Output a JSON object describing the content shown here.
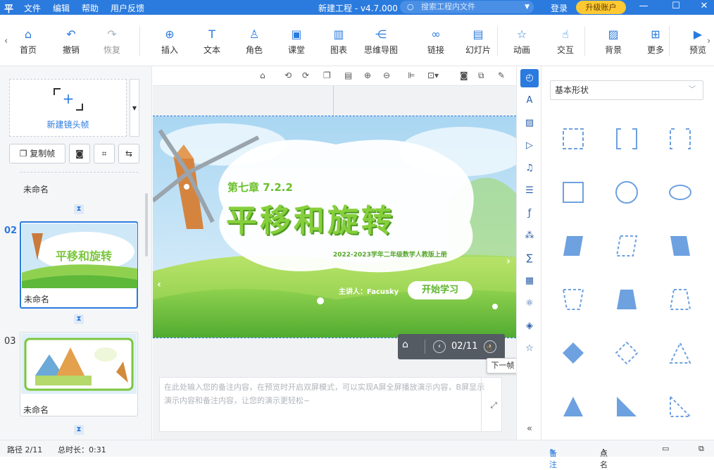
{
  "app": {
    "logo": "平",
    "menu": [
      "文件",
      "编辑",
      "帮助",
      "用户反馈"
    ],
    "title": "新建工程 - v4.7.000",
    "search_placeholder": "搜索工程内文件",
    "login": "登录",
    "upgrade": "升级账户"
  },
  "toolbar": {
    "items": [
      {
        "label": "首页",
        "icon": "home-icon",
        "glyph": "⌂"
      },
      {
        "label": "撤销",
        "icon": "undo-icon",
        "glyph": "↶"
      },
      {
        "label": "恢复",
        "icon": "redo-icon",
        "glyph": "↷",
        "disabled": true
      },
      {
        "label": "插入",
        "icon": "plus-circle-icon",
        "glyph": "⊕"
      },
      {
        "label": "文本",
        "icon": "text-icon",
        "glyph": "T"
      },
      {
        "label": "角色",
        "icon": "person-icon",
        "glyph": "♙"
      },
      {
        "label": "课堂",
        "icon": "classroom-icon",
        "glyph": "▣"
      },
      {
        "label": "图表",
        "icon": "bar-chart-icon",
        "glyph": "▥"
      },
      {
        "label": "思维导图",
        "icon": "mindmap-icon",
        "glyph": "⋲"
      },
      {
        "label": "链接",
        "icon": "link-icon",
        "glyph": "∞"
      },
      {
        "label": "幻灯片",
        "icon": "slides-icon",
        "glyph": "▤"
      },
      {
        "label": "动画",
        "icon": "star-icon",
        "glyph": "☆"
      },
      {
        "label": "交互",
        "icon": "hand-icon",
        "glyph": "☝"
      },
      {
        "label": "背景",
        "icon": "background-icon",
        "glyph": "▨"
      },
      {
        "label": "更多",
        "icon": "grid-icon",
        "glyph": "⊞"
      },
      {
        "label": "预览",
        "icon": "play-icon",
        "glyph": "▶"
      }
    ]
  },
  "left": {
    "new_frame": "新建镜头帧",
    "copy_frame": "复制帧",
    "frames": [
      {
        "label": "未命名"
      },
      {
        "num": "02",
        "label": "未命名"
      },
      {
        "num": "03",
        "label": "未命名"
      }
    ]
  },
  "slide": {
    "chapter": "第七章  7.2.2",
    "title": "平移和旋转",
    "subtitle": "2022-2023学年二年级数学人教版上册",
    "presenter": "主讲人：Facusky",
    "start": "开始学习"
  },
  "player": {
    "counter": "02/11",
    "tooltip": "下一帧"
  },
  "notes": {
    "placeholder": "在此处输入您的备注内容，在预览时开启双屏模式，可以实现A屏全屏播放演示内容，B屏显示演示内容和备注内容，让您的演示更轻松~"
  },
  "shapes": {
    "category": "基本形状"
  },
  "status": {
    "path": "路径 2/11",
    "duration": "总时长：0:31",
    "notes": "备注",
    "roll": "点名"
  },
  "colors": {
    "accent": "#2b7bde",
    "upgrade": "#ffc933",
    "slide_green": "#7cc63e"
  }
}
